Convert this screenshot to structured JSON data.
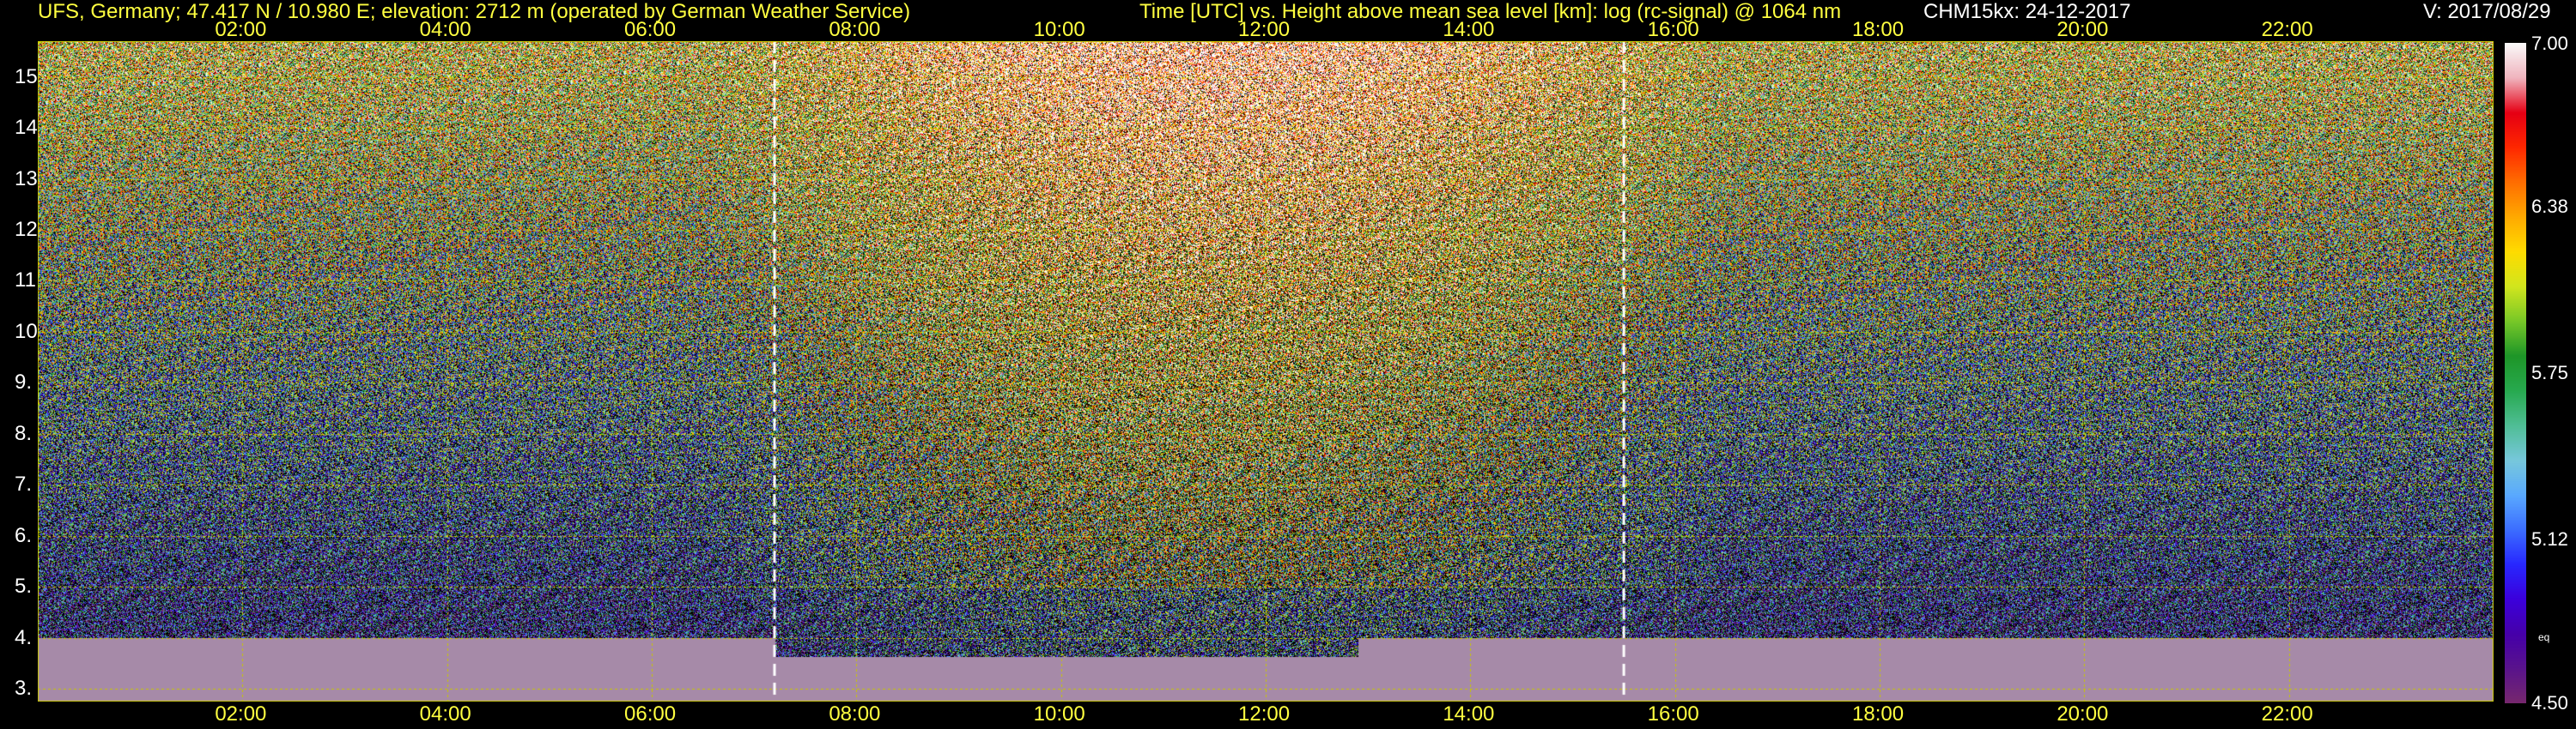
{
  "header": {
    "station": "UFS, Germany; 47.417 N / 10.980 E; elevation: 2712 m  (operated by German Weather Service)",
    "title": "Time [UTC] vs. Height above mean sea level [km]: log (rc-signal) @ 1064 nm",
    "instrument": "CHM15kx: 24-12-2017",
    "version": "V: 2017/08/29"
  },
  "colors": {
    "background": "#000000",
    "label_text": "#ffff40",
    "tick_text": "#ffffff",
    "grid": "#c8c800",
    "ground_band": "#a68aa8"
  },
  "chart_data": {
    "type": "heatmap",
    "title": "Time [UTC] vs. Height above mean sea level [km]: log (rc-signal) @ 1064 nm",
    "xlabel": "Time [UTC]",
    "ylabel": "Height above mean sea level [km]",
    "x_ticks": [
      "02:00",
      "04:00",
      "06:00",
      "08:00",
      "10:00",
      "12:00",
      "14:00",
      "16:00",
      "18:00",
      "20:00",
      "22:00"
    ],
    "x_tick_hours": [
      2,
      4,
      6,
      8,
      10,
      12,
      14,
      16,
      18,
      20,
      22
    ],
    "xlim_hours": [
      0,
      24
    ],
    "y_ticks": [
      "3.",
      "4.",
      "5.",
      "6.",
      "7.",
      "8.",
      "9.",
      "10.",
      "11.",
      "12.",
      "13.",
      "14.",
      "15."
    ],
    "y_tick_values": [
      3,
      4,
      5,
      6,
      7,
      8,
      9,
      10,
      11,
      12,
      13,
      14,
      15
    ],
    "ylim_km": [
      2.75,
      15.7
    ],
    "grid": true,
    "colorbar": {
      "ticks": [
        "7.00",
        "6.38",
        "5.75",
        "5.12",
        "4.50"
      ],
      "tick_values": [
        7.0,
        6.38,
        5.75,
        5.12,
        4.5
      ],
      "range": [
        4.5,
        7.0
      ],
      "small_label": "eq"
    },
    "markers_hours": [
      7.2,
      15.5
    ],
    "ground_band_top_km": 4.0,
    "ground_band_dip_hours": [
      7.2,
      12.9
    ]
  }
}
